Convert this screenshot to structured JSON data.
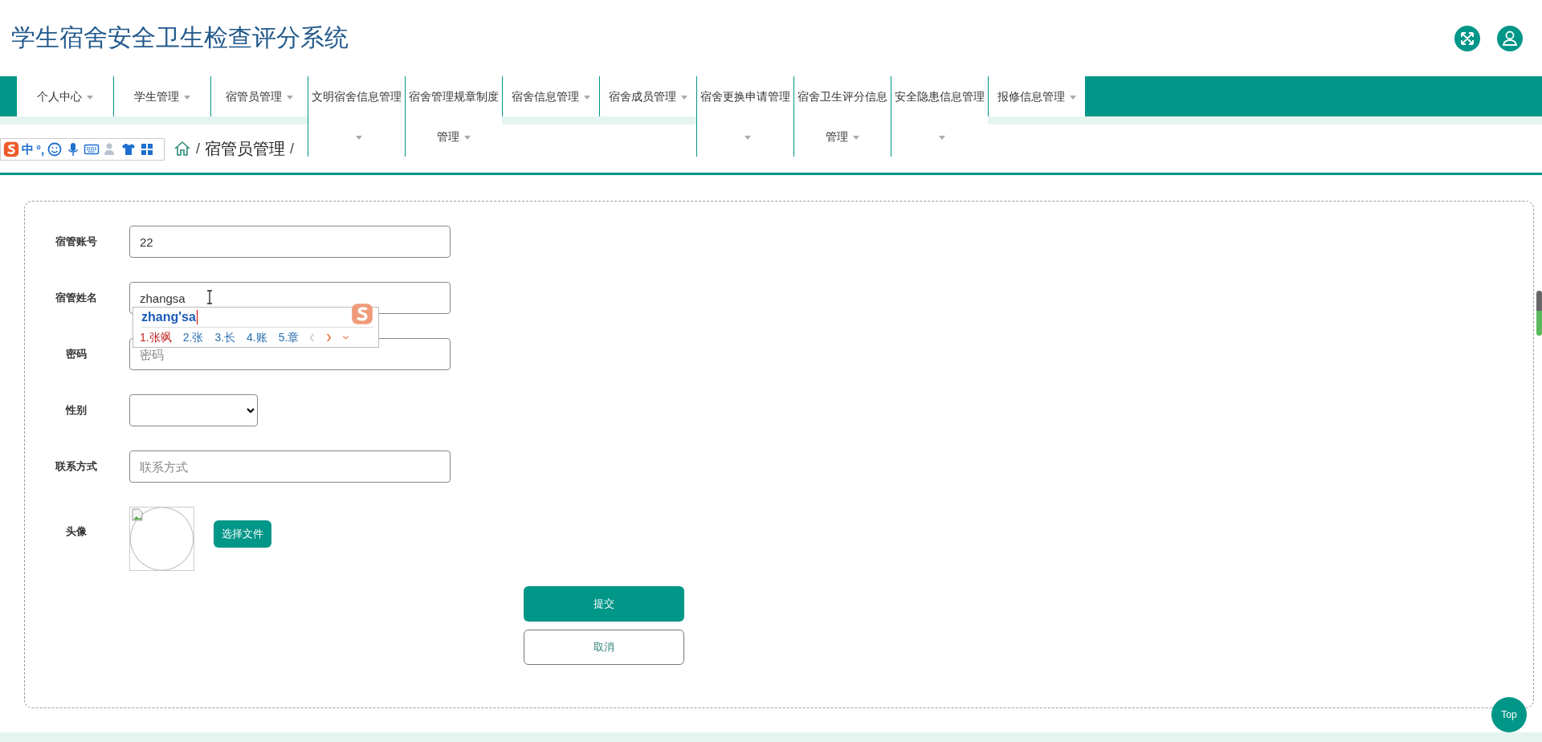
{
  "header": {
    "title": "学生宿舍安全卫生检查评分系统"
  },
  "nav": [
    {
      "label": "个人中心"
    },
    {
      "label": "学生管理"
    },
    {
      "label": "宿管员管理"
    },
    {
      "label": "文明宿舍信息管理"
    },
    {
      "label": "宿舍管理规章制度管理"
    },
    {
      "label": "宿舍信息管理"
    },
    {
      "label": "宿舍成员管理"
    },
    {
      "label": "宿舍更换申请管理"
    },
    {
      "label": "宿舍卫生评分信息管理"
    },
    {
      "label": "安全隐患信息管理"
    },
    {
      "label": "报修信息管理"
    }
  ],
  "breadcrumb": [
    {
      "kind": "separator",
      "text": "/"
    },
    {
      "kind": "link",
      "text": "宿管员管理"
    },
    {
      "kind": "separator",
      "text": "/"
    }
  ],
  "ime_toolbar": {
    "mode": "中",
    "punctuation": "°,"
  },
  "form": {
    "fields": [
      {
        "kind": "input",
        "label": "宿管账号",
        "value": "22"
      },
      {
        "kind": "input",
        "label": "宿管姓名",
        "value": "zhangsa"
      },
      {
        "kind": "input",
        "label": "密码",
        "placeholder": "密码"
      },
      {
        "kind": "select",
        "label": "性别"
      },
      {
        "kind": "input",
        "label": "联系方式",
        "placeholder": "联系方式"
      },
      {
        "kind": "avatar",
        "label": "头像",
        "button": "选择文件"
      }
    ],
    "submit": "提交",
    "cancel": "取消"
  },
  "ime_popup": {
    "composition": "zhang'sa",
    "candidates": [
      {
        "text": "1.张飒",
        "selected": true
      },
      {
        "text": "2.张",
        "selected": false
      },
      {
        "text": "3.长",
        "selected": false
      },
      {
        "text": "4.账",
        "selected": false
      },
      {
        "text": "5.章",
        "selected": false
      }
    ]
  },
  "top_button": "Top"
}
